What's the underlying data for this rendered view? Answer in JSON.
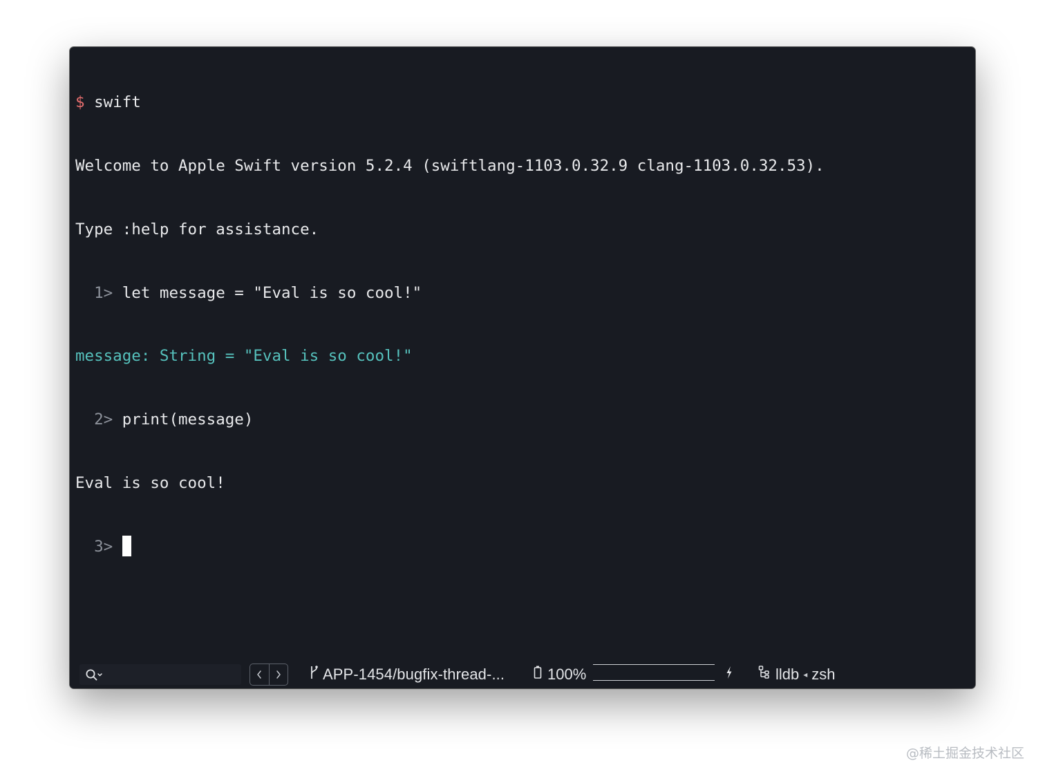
{
  "terminal": {
    "lines": [
      {
        "prompt": "$",
        "text": " swift"
      },
      {
        "text": "Welcome to Apple Swift version 5.2.4 (swiftlang-1103.0.32.9 clang-1103.0.32.53)."
      },
      {
        "text": "Type :help for assistance."
      },
      {
        "prompt": "  1>",
        "text": " let message = \"Eval is so cool!\""
      },
      {
        "text": "message: String = \"Eval is so cool!\""
      },
      {
        "prompt": "  2>",
        "text": " print(message)"
      },
      {
        "text": "Eval is so cool!"
      },
      {
        "prompt": "  3>",
        "text": " "
      }
    ]
  },
  "statusbar": {
    "search_icon": "search-icon",
    "back_icon": "chevron-left-icon",
    "forward_icon": "chevron-right-icon",
    "branch_icon": "git-branch-icon",
    "branch": "APP-1454/bugfix-thread-...",
    "battery_icon": "battery-icon",
    "battery": "100%",
    "battery_level": 1.0,
    "bolt_icon": "charging-bolt-icon",
    "session_icon": "process-tree-icon",
    "session_left": "lldb",
    "session_sep": "◂",
    "session_right": "zsh"
  },
  "watermark": "@稀土掘金技术社区",
  "colors": {
    "background": "#181b22",
    "prompt_dollar": "#e36d6d",
    "output_teal": "#56c2bd",
    "dim_prompt": "#8d929b"
  }
}
